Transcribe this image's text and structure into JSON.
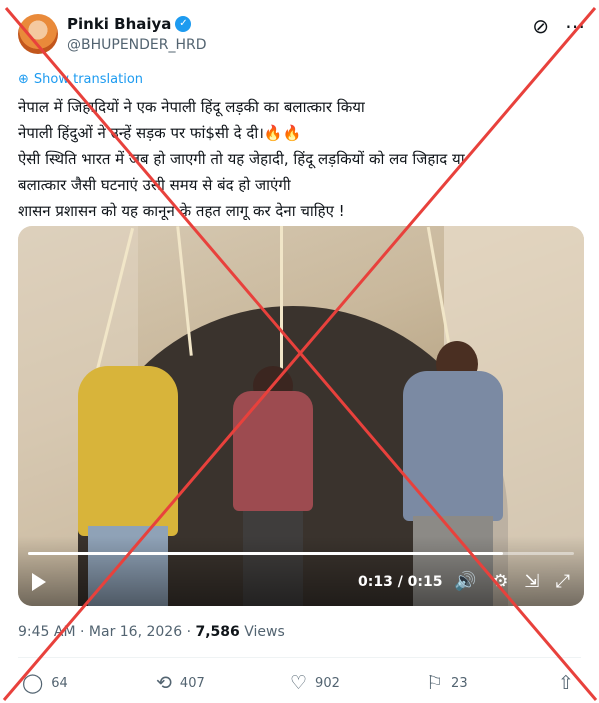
{
  "post": {
    "display_name": "Pinki Bhaiya",
    "verified_icon": "check-icon",
    "handle": "@BHUPENDER_HRD",
    "show_translation": "Show translation",
    "lines": [
      "नेपाल में जिहादियों ने एक नेपाली हिंदू लड़की का बलात्कार किया",
      "नेपाली हिंदुओं ने उन्हें सड़क पर फां$सी दे दी।🔥🔥",
      "ऐसी स्थिति भारत में जब हो जाएगी तो यह जेहादी, हिंदू लड़कियों को लव जिहाद या",
      "बलात्कार जैसी घटनाएं उसी समय से बंद हो जाएंगी",
      "शासन प्रशासन को यह कानून के तहत लागू कर देना चाहिए !"
    ]
  },
  "video": {
    "time": "0:13 / 0:15",
    "progress": 0.87
  },
  "meta": {
    "time": "9:45 AM",
    "sep": "·",
    "date": "Mar 16, 2026",
    "views_count": "7,586",
    "views_label": "Views"
  },
  "actions": {
    "replies": "64",
    "reposts": "407",
    "likes": "902",
    "bookmarks": "23"
  },
  "colors": {
    "accent": "#1d9bf0",
    "cross": "#e8413c"
  }
}
